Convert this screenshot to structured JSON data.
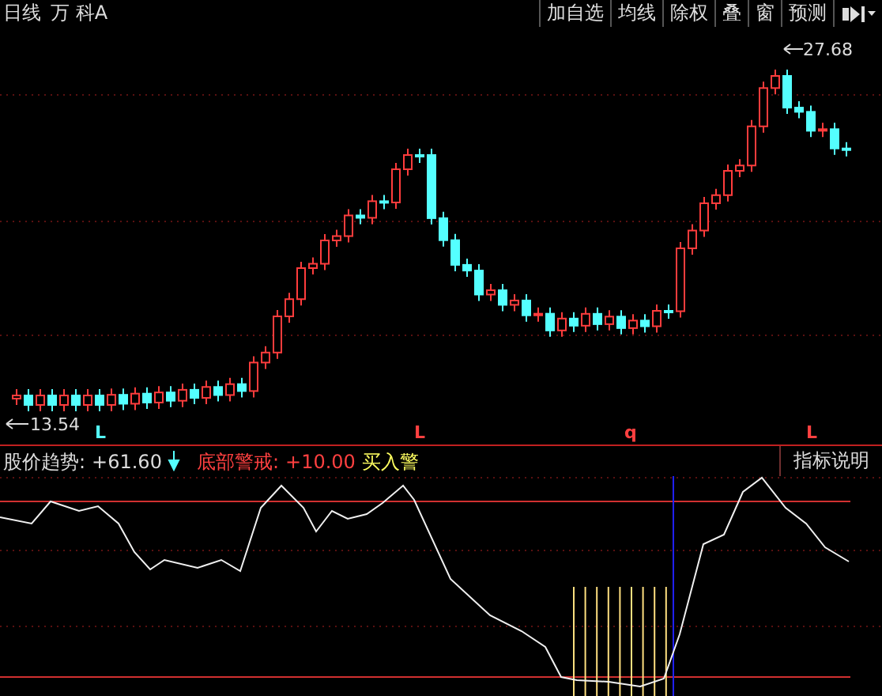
{
  "header": {
    "period": "日线",
    "stock": "万 科A"
  },
  "toolbar": {
    "buttons": [
      "加自选",
      "均线",
      "除权",
      "叠",
      "窗",
      "预测"
    ]
  },
  "price_chart": {
    "high_label": "27.68",
    "low_label": "13.54",
    "signals": [
      {
        "text": "L",
        "color": "#54ffff"
      },
      {
        "text": "L",
        "color": "#ff4040"
      },
      {
        "text": "q",
        "color": "#ff4040"
      },
      {
        "text": "L",
        "color": "#ff4040"
      }
    ]
  },
  "indicator": {
    "trend_label": "股价趋势:",
    "trend_value": "+61.60",
    "alert_label": "底部警戒:",
    "alert_value": "+10.00",
    "buy_label": "买入警",
    "help_button": "指标说明"
  }
}
